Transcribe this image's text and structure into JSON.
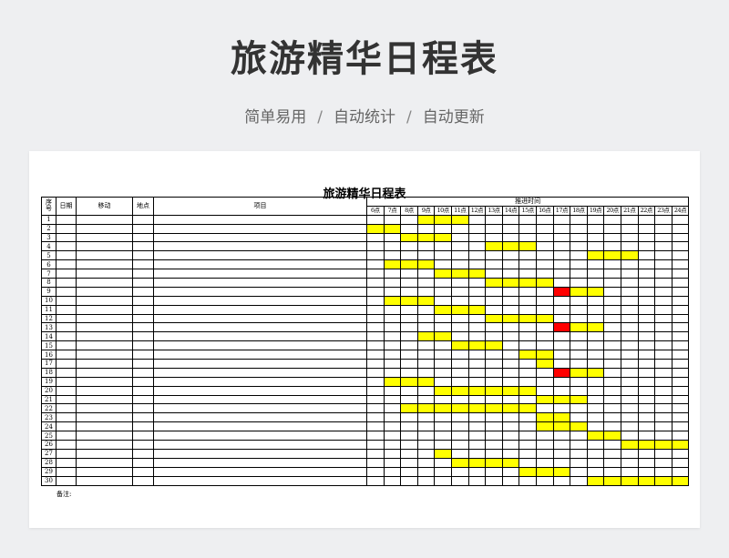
{
  "page": {
    "title": "旅游精华日程表",
    "subtitle": [
      "简单易用",
      "自动统计",
      "自动更新"
    ],
    "separator": "/"
  },
  "sheet": {
    "title": "旅游精华日程表",
    "headers": {
      "seq": "序号",
      "date": "日期",
      "move": "移动",
      "place": "地点",
      "item": "项目",
      "timeline": "推进时间"
    },
    "hours": [
      "6点",
      "7点",
      "8点",
      "9点",
      "10点",
      "11点",
      "12点",
      "13点",
      "14点",
      "15点",
      "16点",
      "17点",
      "18点",
      "19点",
      "20点",
      "21点",
      "22点",
      "23点",
      "24点"
    ],
    "note_label": "备注:",
    "colors": {
      "yellow": "#ffff00",
      "red": "#ff0000"
    },
    "rows": [
      {
        "no": "1",
        "bars": [
          {
            "from": "9点",
            "to": "11点",
            "color": "yellow"
          }
        ]
      },
      {
        "no": "2",
        "bars": [
          {
            "from": "6点",
            "to": "7点",
            "color": "yellow"
          }
        ]
      },
      {
        "no": "3",
        "bars": [
          {
            "from": "8点",
            "to": "10点",
            "color": "yellow"
          }
        ]
      },
      {
        "no": "4",
        "bars": [
          {
            "from": "13点",
            "to": "15点",
            "color": "yellow"
          }
        ]
      },
      {
        "no": "5",
        "bars": [
          {
            "from": "19点",
            "to": "21点",
            "color": "yellow"
          }
        ]
      },
      {
        "no": "6",
        "bars": [
          {
            "from": "7点",
            "to": "9点",
            "color": "yellow"
          }
        ]
      },
      {
        "no": "7",
        "bars": [
          {
            "from": "10点",
            "to": "12点",
            "color": "yellow"
          }
        ]
      },
      {
        "no": "8",
        "bars": [
          {
            "from": "13点",
            "to": "16点",
            "color": "yellow"
          }
        ]
      },
      {
        "no": "9",
        "bars": [
          {
            "from": "17点",
            "to": "17点",
            "color": "red"
          },
          {
            "from": "18点",
            "to": "19点",
            "color": "yellow"
          }
        ]
      },
      {
        "no": "10",
        "bars": [
          {
            "from": "7点",
            "to": "9点",
            "color": "yellow"
          }
        ]
      },
      {
        "no": "11",
        "bars": [
          {
            "from": "10点",
            "to": "12点",
            "color": "yellow"
          }
        ]
      },
      {
        "no": "12",
        "bars": [
          {
            "from": "13点",
            "to": "16点",
            "color": "yellow"
          }
        ]
      },
      {
        "no": "13",
        "bars": [
          {
            "from": "17点",
            "to": "17点",
            "color": "red"
          },
          {
            "from": "18点",
            "to": "19点",
            "color": "yellow"
          }
        ]
      },
      {
        "no": "14",
        "bars": [
          {
            "from": "9点",
            "to": "10点",
            "color": "yellow"
          }
        ]
      },
      {
        "no": "15",
        "bars": [
          {
            "from": "11点",
            "to": "13点",
            "color": "yellow"
          }
        ]
      },
      {
        "no": "16",
        "bars": [
          {
            "from": "15点",
            "to": "16点",
            "color": "yellow"
          }
        ]
      },
      {
        "no": "17",
        "bars": [
          {
            "from": "16点",
            "to": "16点",
            "color": "yellow"
          }
        ]
      },
      {
        "no": "18",
        "bars": [
          {
            "from": "17点",
            "to": "17点",
            "color": "red"
          },
          {
            "from": "18点",
            "to": "19点",
            "color": "yellow"
          }
        ]
      },
      {
        "no": "19",
        "bars": [
          {
            "from": "7点",
            "to": "9点",
            "color": "yellow"
          }
        ]
      },
      {
        "no": "20",
        "bars": [
          {
            "from": "10点",
            "to": "15点",
            "color": "yellow"
          }
        ]
      },
      {
        "no": "21",
        "bars": [
          {
            "from": "16点",
            "to": "18点",
            "color": "yellow"
          }
        ]
      },
      {
        "no": "22",
        "bars": [
          {
            "from": "8点",
            "to": "15点",
            "color": "yellow"
          }
        ]
      },
      {
        "no": "23",
        "bars": [
          {
            "from": "16点",
            "to": "17点",
            "color": "yellow"
          }
        ]
      },
      {
        "no": "24",
        "bars": [
          {
            "from": "16点",
            "to": "18点",
            "color": "yellow"
          }
        ]
      },
      {
        "no": "25",
        "bars": [
          {
            "from": "19点",
            "to": "20点",
            "color": "yellow"
          }
        ]
      },
      {
        "no": "26",
        "bars": [
          {
            "from": "21点",
            "to": "24点",
            "color": "yellow"
          }
        ]
      },
      {
        "no": "27",
        "bars": [
          {
            "from": "10点",
            "to": "10点",
            "color": "yellow"
          }
        ]
      },
      {
        "no": "28",
        "bars": [
          {
            "from": "11点",
            "to": "14点",
            "color": "yellow"
          }
        ]
      },
      {
        "no": "29",
        "bars": [
          {
            "from": "15点",
            "to": "17点",
            "color": "yellow"
          }
        ]
      },
      {
        "no": "30",
        "bars": [
          {
            "from": "19点",
            "to": "24点",
            "color": "yellow"
          }
        ]
      }
    ]
  }
}
